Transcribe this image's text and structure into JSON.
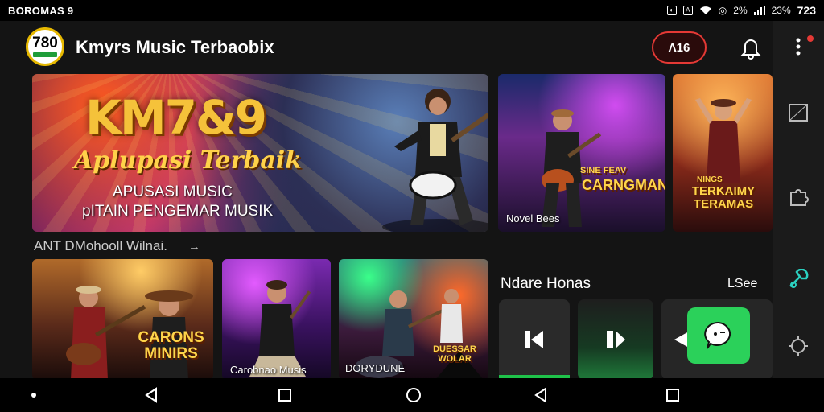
{
  "status_bar": {
    "left_text": "BOROMAS 9",
    "battery_1": "2%",
    "battery_2": "23%",
    "time": "723"
  },
  "header": {
    "logo_text": "780",
    "app_title": "Kmyrs Music Terbaobix",
    "pill_label": "Λ16"
  },
  "banners": {
    "main": {
      "title": "KM7&9",
      "subtitle": "Aplupasi Terbaik",
      "line1": "APUSASI MUSIC",
      "line2": "pITAIN PENGEMAR MUSIK"
    },
    "second": {
      "title": "CARNGMAN",
      "title_small": "SINE FEAV",
      "caption": "Novel Bees"
    },
    "third": {
      "title": "TERKAIMY TERAMAS",
      "title_small": "NINGS"
    }
  },
  "section": {
    "title": "ANT DMohooll Wilnai."
  },
  "cards": [
    {
      "caption": "CARONS MINIRS"
    },
    {
      "caption": "Carobnao Musis"
    },
    {
      "caption": "DORYDUNE",
      "overlay": "DUESSAR WOLAR"
    }
  ],
  "player": {
    "title": "Ndare Honas",
    "see_all": "LSee"
  },
  "colors": {
    "accent_green": "#2bd15a",
    "accent_red": "#e53935",
    "gold": "#f5c23a"
  }
}
